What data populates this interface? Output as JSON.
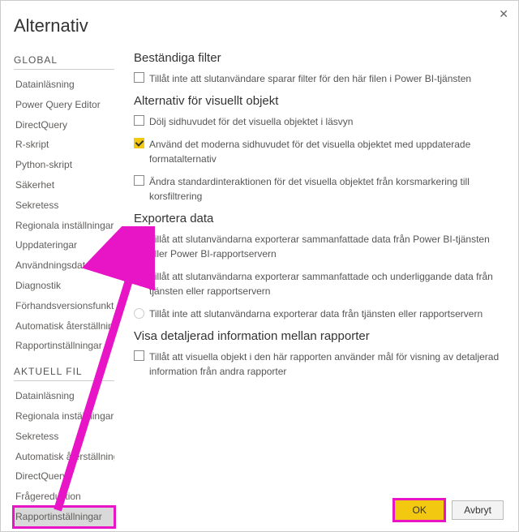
{
  "window": {
    "title": "Alternativ"
  },
  "sidebar": {
    "global_heading": "GLOBAL",
    "global_items": [
      "Datainläsning",
      "Power Query Editor",
      "DirectQuery",
      "R-skript",
      "Python-skript",
      "Säkerhet",
      "Sekretess",
      "Regionala inställningar",
      "Uppdateringar",
      "Användningsdata",
      "Diagnostik",
      "Förhandsversionsfunktioner",
      "Automatisk återställning",
      "Rapportinställningar"
    ],
    "current_heading": "AKTUELL FIL",
    "current_items": [
      "Datainläsning",
      "Regionala inställningar",
      "Sekretess",
      "Automatisk återställning",
      "DirectQuery",
      "Frågereduktion",
      "Rapportinställningar"
    ]
  },
  "sections": {
    "persistent": {
      "title": "Beständiga filter",
      "opt1": "Tillåt inte att slutanvändare sparar filter för den här filen i Power BI-tjänsten"
    },
    "visual": {
      "title": "Alternativ för visuellt objekt",
      "opt1": "Dölj sidhuvudet för det visuella objektet i läsvyn",
      "opt2": "Använd det moderna sidhuvudet för det visuella objektet med uppdaterade formatalternativ",
      "opt3": "Ändra standardinteraktionen för det visuella objektet från korsmarkering till korsfiltrering"
    },
    "export": {
      "title": "Exportera data",
      "opt1": "Tillåt att slutanvändarna exporterar sammanfattade data från Power BI-tjänsten eller Power BI-rapportservern",
      "opt2": "Tillåt att slutanvändarna exporterar sammanfattade och underliggande data från tjänsten eller rapportservern",
      "opt3": "Tillåt inte att slutanvändarna exporterar data från tjänsten eller rapportservern"
    },
    "crossreport": {
      "title": "Visa detaljerad information mellan rapporter",
      "opt1": "Tillåt att visuella objekt i den här rapporten använder mål för visning av detaljerad information från andra rapporter"
    }
  },
  "footer": {
    "ok": "OK",
    "cancel": "Avbryt"
  }
}
